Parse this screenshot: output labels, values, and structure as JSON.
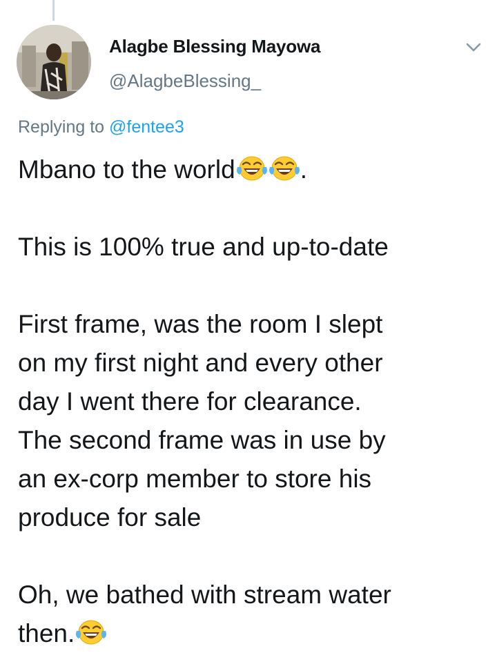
{
  "tweet": {
    "author": {
      "display_name": "Alagbe Blessing Mayowa",
      "handle": "@AlagbeBlessing_"
    },
    "reply": {
      "prefix": "Replying to ",
      "mention": "@fentee3"
    },
    "text": {
      "p1": "Mbano to the world",
      "p1_end": ".",
      "p2": "This is 100% true and up-to-date",
      "p3_l1": "First frame, was the room I slept",
      "p3_l2": "on my first night and every other",
      "p3_l3": "day I went there for clearance.",
      "p3_l4": "The second frame was in use by",
      "p3_l5": "an ex-corp member to store his",
      "p3_l6": "produce for sale",
      "p4_l1": "Oh, we bathed with stream water",
      "p4_l2": "then."
    },
    "icons": {
      "menu": "chevron-down-icon",
      "emoji": "face-with-tears-of-joy-icon"
    }
  },
  "colors": {
    "text": "#14171a",
    "secondary": "#657786",
    "link": "#1da1f2",
    "thread_line": "#ccd6dd"
  }
}
